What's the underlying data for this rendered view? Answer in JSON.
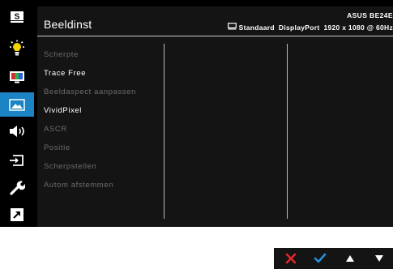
{
  "sidebar": {
    "items": [
      {
        "icon": "splendid-icon",
        "label": "S"
      },
      {
        "icon": "blue-light-filter-icon"
      },
      {
        "icon": "color-icon"
      },
      {
        "icon": "image-icon",
        "active": true
      },
      {
        "icon": "sound-icon"
      },
      {
        "icon": "input-select-icon"
      },
      {
        "icon": "system-setup-icon"
      },
      {
        "icon": "shortcut-icon"
      }
    ]
  },
  "header": {
    "title": "Beeldinst",
    "model": "ASUS BE24E",
    "status": {
      "mode": "Standaard",
      "input": "DisplayPort",
      "resolution": "1920 x 1080 @ 60Hz"
    }
  },
  "menu": {
    "items": [
      {
        "label": "Scherpte",
        "enabled": false
      },
      {
        "label": "Trace Free",
        "enabled": true
      },
      {
        "label": "Beeldaspect aanpassen",
        "enabled": false
      },
      {
        "label": "VividPixel",
        "enabled": true
      },
      {
        "label": "ASCR",
        "enabled": false
      },
      {
        "label": "Positie",
        "enabled": false
      },
      {
        "label": "Scherpstellen",
        "enabled": false
      },
      {
        "label": "Autom afstemmen",
        "enabled": false
      }
    ]
  },
  "nav": {
    "buttons": [
      {
        "icon": "close-icon",
        "color": "#e0282b"
      },
      {
        "icon": "check-icon",
        "color": "#2a8fd6"
      },
      {
        "icon": "up-arrow-icon",
        "color": "#ffffff"
      },
      {
        "icon": "down-arrow-icon",
        "color": "#ffffff"
      }
    ]
  },
  "colors": {
    "accent": "#1b84c4",
    "background": "#000000",
    "panel": "#141414",
    "text_enabled": "#ffffff",
    "text_disabled": "#6d6d6d"
  }
}
